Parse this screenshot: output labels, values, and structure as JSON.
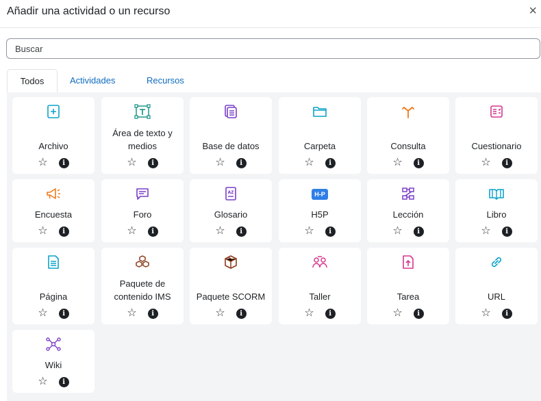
{
  "dialog": {
    "title": "Añadir una actividad o un recurso",
    "close_icon": "×"
  },
  "search": {
    "placeholder": "Buscar"
  },
  "tabs": [
    {
      "label": "Todos",
      "active": true
    },
    {
      "label": "Actividades",
      "active": false
    },
    {
      "label": "Recursos",
      "active": false
    }
  ],
  "colors": {
    "link": "#0f6cbf",
    "background": "#f3f4f6"
  },
  "items": [
    {
      "label": "Archivo",
      "icon": "file-plus-icon",
      "color": "#0ba3c9"
    },
    {
      "label": "Área de texto y medios",
      "icon": "text-area-icon",
      "color": "#0d8f82"
    },
    {
      "label": "Base de datos",
      "icon": "database-icon",
      "color": "#7a3ec8"
    },
    {
      "label": "Carpeta",
      "icon": "folder-icon",
      "color": "#0ba3c9"
    },
    {
      "label": "Consulta",
      "icon": "choice-arrows-icon",
      "color": "#f07a1a"
    },
    {
      "label": "Cuestionario",
      "icon": "quiz-icon",
      "color": "#d6378f"
    },
    {
      "label": "Encuesta",
      "icon": "megaphone-icon",
      "color": "#f07a1a"
    },
    {
      "label": "Foro",
      "icon": "chat-bubble-icon",
      "color": "#7a3ec8"
    },
    {
      "label": "Glosario",
      "icon": "glossary-book-icon",
      "color": "#7a3ec8"
    },
    {
      "label": "H5P",
      "icon": "h5p-icon",
      "color": "#2f7fe6"
    },
    {
      "label": "Lección",
      "icon": "lesson-flow-icon",
      "color": "#7a3ec8"
    },
    {
      "label": "Libro",
      "icon": "open-book-icon",
      "color": "#0ba3c9"
    },
    {
      "label": "Página",
      "icon": "page-icon",
      "color": "#0ba3c9"
    },
    {
      "label": "Paquete de contenido IMS",
      "icon": "package-boxes-icon",
      "color": "#8a3b1a"
    },
    {
      "label": "Paquete SCORM",
      "icon": "package-box-icon",
      "color": "#8a3b1a"
    },
    {
      "label": "Taller",
      "icon": "workshop-people-icon",
      "color": "#d6378f"
    },
    {
      "label": "Tarea",
      "icon": "assignment-upload-icon",
      "color": "#d6378f"
    },
    {
      "label": "URL",
      "icon": "link-icon",
      "color": "#0ba3c9"
    },
    {
      "label": "Wiki",
      "icon": "wiki-network-icon",
      "color": "#7a3ec8"
    }
  ],
  "actions": {
    "star_glyph": "☆",
    "info_glyph": "i",
    "h5p_text": "H-P"
  }
}
